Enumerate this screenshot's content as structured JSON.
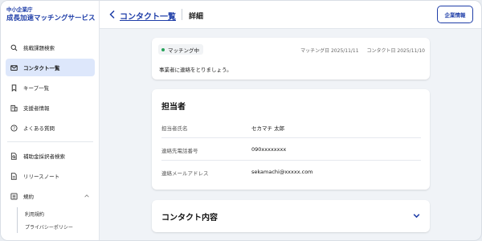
{
  "brand": {
    "org": "中小企業庁",
    "name": "成長加速マッチングサービス"
  },
  "sidebar": {
    "items": [
      {
        "label": "挑戦課題検索",
        "icon": "search-icon"
      },
      {
        "label": "コンタクト一覧",
        "icon": "mail-icon",
        "active": true
      },
      {
        "label": "キープ一覧",
        "icon": "bookmark-icon"
      },
      {
        "label": "支援者情報",
        "icon": "building-icon"
      },
      {
        "label": "よくある質問",
        "icon": "question-icon"
      }
    ],
    "lower_items": [
      {
        "label": "補助金採択者検索",
        "icon": "document-search-icon"
      },
      {
        "label": "リリースノート",
        "icon": "document-icon"
      },
      {
        "label": "規約",
        "icon": "list-icon",
        "expanded": true
      }
    ],
    "sub_items": [
      {
        "label": "利用規約"
      },
      {
        "label": "プライバシーポリシー"
      }
    ]
  },
  "header": {
    "breadcrumb_link": "コンタクト一覧",
    "breadcrumb_current": "詳細",
    "company_button": "企業情報"
  },
  "status_card": {
    "badge": "マッチング中",
    "badge_color": "#27a35a",
    "matching_date": "マッチング日 2025/11/11",
    "contact_date": "コンタクト日 2025/11/10",
    "message": "事業者に連絡をとりましょう。"
  },
  "contact_person": {
    "title": "担当者",
    "rows": [
      {
        "label": "担当者氏名",
        "value": "セカマチ 太郎"
      },
      {
        "label": "連絡先電話番号",
        "value": "090xxxxxxxx"
      },
      {
        "label": "連絡メールアドレス",
        "value": "sekamachi@xxxxx.com"
      }
    ]
  },
  "contact_content": {
    "title": "コンタクト内容"
  },
  "colors": {
    "accent": "#1f3ea8",
    "active_bg": "#dde7fb",
    "page_bg": "#f0f3f7"
  }
}
